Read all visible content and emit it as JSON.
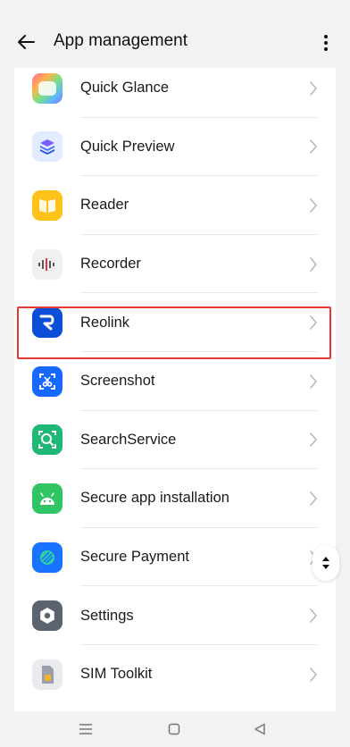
{
  "header": {
    "title": "App management"
  },
  "apps": [
    {
      "label": "Quick Glance",
      "icon": "quick-glance-icon"
    },
    {
      "label": "Quick Preview",
      "icon": "quick-preview-icon"
    },
    {
      "label": "Reader",
      "icon": "reader-icon"
    },
    {
      "label": "Recorder",
      "icon": "recorder-icon"
    },
    {
      "label": "Reolink",
      "icon": "reolink-icon"
    },
    {
      "label": "Screenshot",
      "icon": "screenshot-icon"
    },
    {
      "label": "SearchService",
      "icon": "search-service-icon"
    },
    {
      "label": "Secure app installation",
      "icon": "android-icon"
    },
    {
      "label": "Secure Payment",
      "icon": "secure-payment-icon"
    },
    {
      "label": "Settings",
      "icon": "settings-icon"
    },
    {
      "label": "SIM Toolkit",
      "icon": "sim-card-icon"
    }
  ],
  "highlighted_item": "Reolink",
  "colors": {
    "background": "#f2f2f4",
    "card": "#ffffff",
    "highlight": "#e53935",
    "text": "#1a1a1a",
    "chevron": "#b8b8bd"
  },
  "navbar": {
    "buttons": [
      "menu-icon",
      "home-icon",
      "back-icon"
    ]
  }
}
